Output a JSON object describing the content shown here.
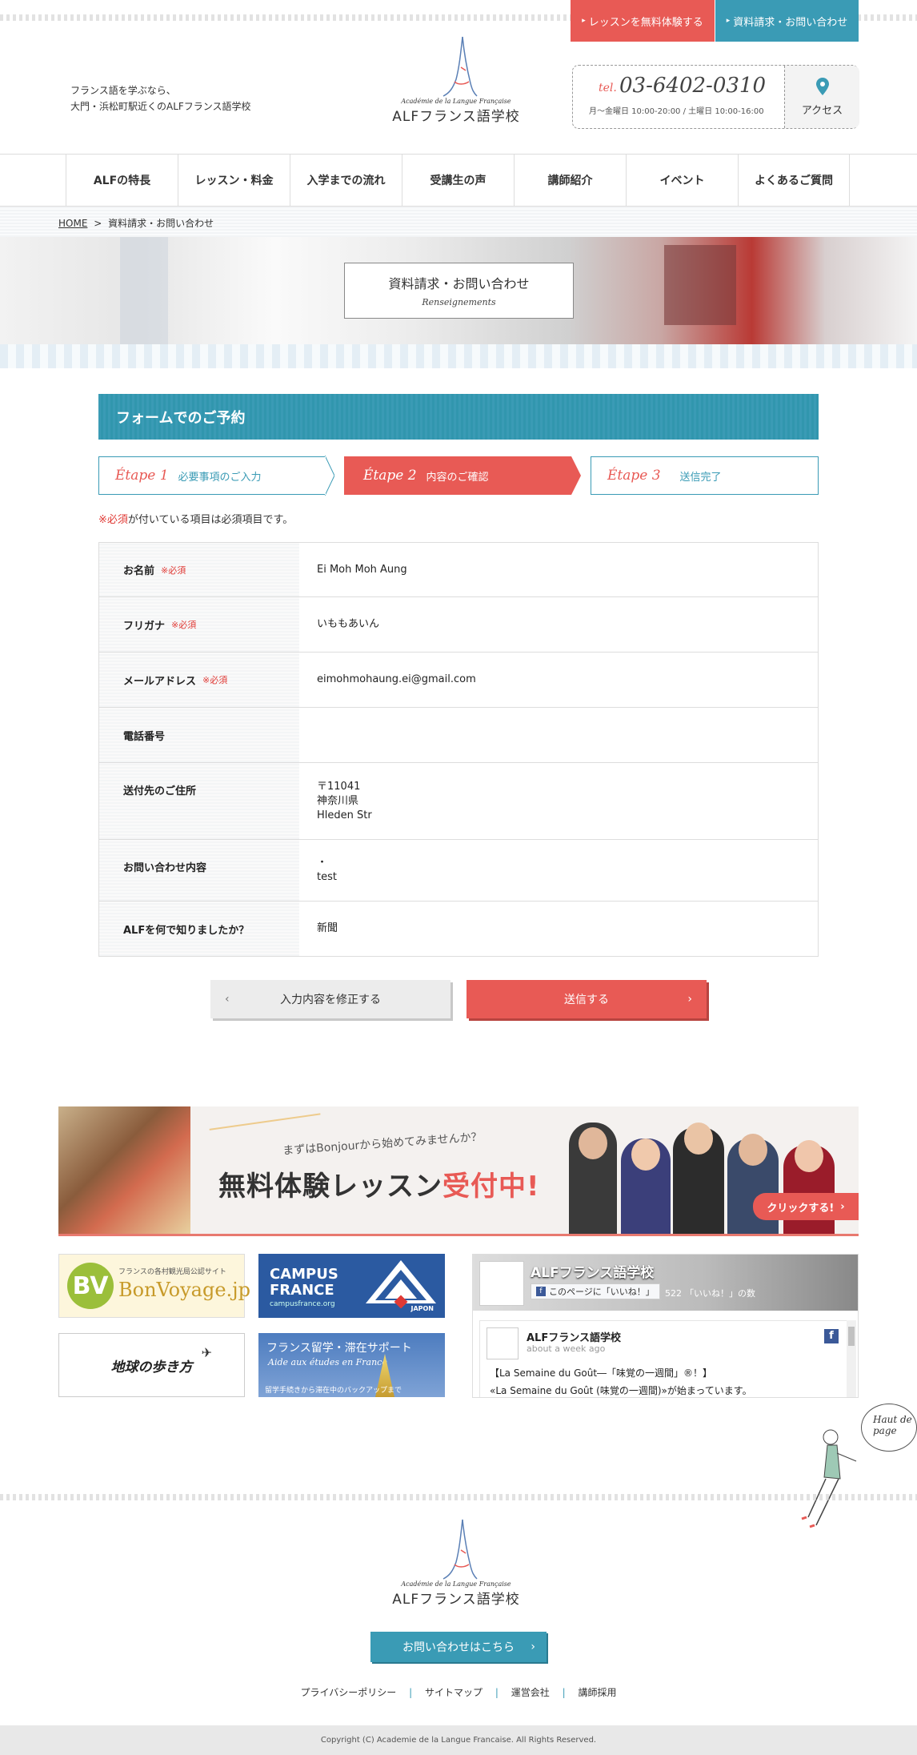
{
  "header": {
    "tagline_line1": "フランス語を学ぶなら、",
    "tagline_line2": "大門・浜松町駅近くのALFフランス語学校",
    "free_lesson_button": "レッスンを無料体験する",
    "request_button": "資料請求・お問い合わせ",
    "logo_small": "Académie de la Langue Française",
    "logo_big": "ALFフランス語学校",
    "tel_label": "tel.",
    "tel_number": "03-6402-0310",
    "tel_hours": "月〜金曜日 10:00-20:00 / 土曜日 10:00-16:00",
    "access_label": "アクセス"
  },
  "nav": {
    "items": [
      "ALFの特長",
      "レッスン・料金",
      "入学までの流れ",
      "受講生の声",
      "講師紹介",
      "イベント",
      "よくあるご質問"
    ]
  },
  "breadcrumb": {
    "home": "HOME",
    "separator": ">",
    "current": "資料請求・お問い合わせ"
  },
  "hero": {
    "title": "資料請求・お問い合わせ",
    "subtitle": "Renseignements"
  },
  "form": {
    "heading": "フォームでのご予約",
    "steps": [
      {
        "etape": "Étape 1",
        "label": "必要事項のご入力"
      },
      {
        "etape": "Étape 2",
        "label": "内容のご確認"
      },
      {
        "etape": "Étape 3",
        "label": "送信完了"
      }
    ],
    "required_note_mark": "※必須",
    "required_note_text": "が付いている項目は必須項目です。",
    "required_tag": "※必須",
    "rows": [
      {
        "label": "お名前",
        "value_lines": [
          "Ei Moh Moh Aung"
        ]
      },
      {
        "label": "フリガナ",
        "value_lines": [
          "いももあいん"
        ]
      },
      {
        "label": "メールアドレス",
        "value_lines": [
          "eimohmohaung.ei@gmail.com"
        ]
      },
      {
        "label": "電話番号",
        "value_lines": []
      },
      {
        "label": "送付先のご住所",
        "value_lines": [
          "〒11041",
          "神奈川県",
          "Hleden Str"
        ]
      },
      {
        "label": "お問い合わせ内容",
        "value_lines": [
          "・",
          "test"
        ]
      },
      {
        "label": "ALFを何で知りましたか？",
        "value_lines": [
          "新聞"
        ]
      }
    ],
    "back_button": "入力内容を修正する",
    "submit_button": "送信する"
  },
  "banner": {
    "lead": "まずはBonjourから始めてみませんか？",
    "main_black": "無料体験レッスン",
    "main_red": "受付中!",
    "click": "クリックする!"
  },
  "links": {
    "bonvoyage_small": "フランスの各村観光局公認サイト",
    "bonvoyage": "BonVoyage.jp",
    "campus_line1": "CAMPUS",
    "campus_line2": "FRANCE",
    "campus_url": "campusfrance.org",
    "campus_japon": "JAPON",
    "chikyu": "地球の歩き方",
    "study_title": "フランス留学・滞在サポート",
    "study_sub": "Aide aux études en France",
    "study_note": "留学手続きから滞在中のバックアップまで"
  },
  "facebook": {
    "page_name": "ALFフランス語学校",
    "like_button": "このページに「いいね！」",
    "like_count": "522",
    "like_suffix": "「いいね！」の数",
    "post_author": "ALFフランス語学校",
    "post_time": "about a week ago",
    "post_line1": "【La Semaine du Goût―「味覚の一週間」®！】",
    "post_line2": "«La Semaine du Goût (味覚の一週間)»が始まっています。"
  },
  "pagetop": {
    "line1": "Haut de",
    "line2": "page"
  },
  "footer": {
    "logo_small": "Académie de la Langue Française",
    "logo_big": "ALFフランス語学校",
    "contact_button": "お問い合わせはこちら",
    "links": [
      "プライバシーポリシー",
      "サイトマップ",
      "運営会社",
      "講師採用"
    ],
    "copyright": "Copyright (C) Academie de la Langue Francaise. All Rights Reserved."
  },
  "colors": {
    "coral": "#e85a55",
    "teal": "#3a9bb5"
  }
}
